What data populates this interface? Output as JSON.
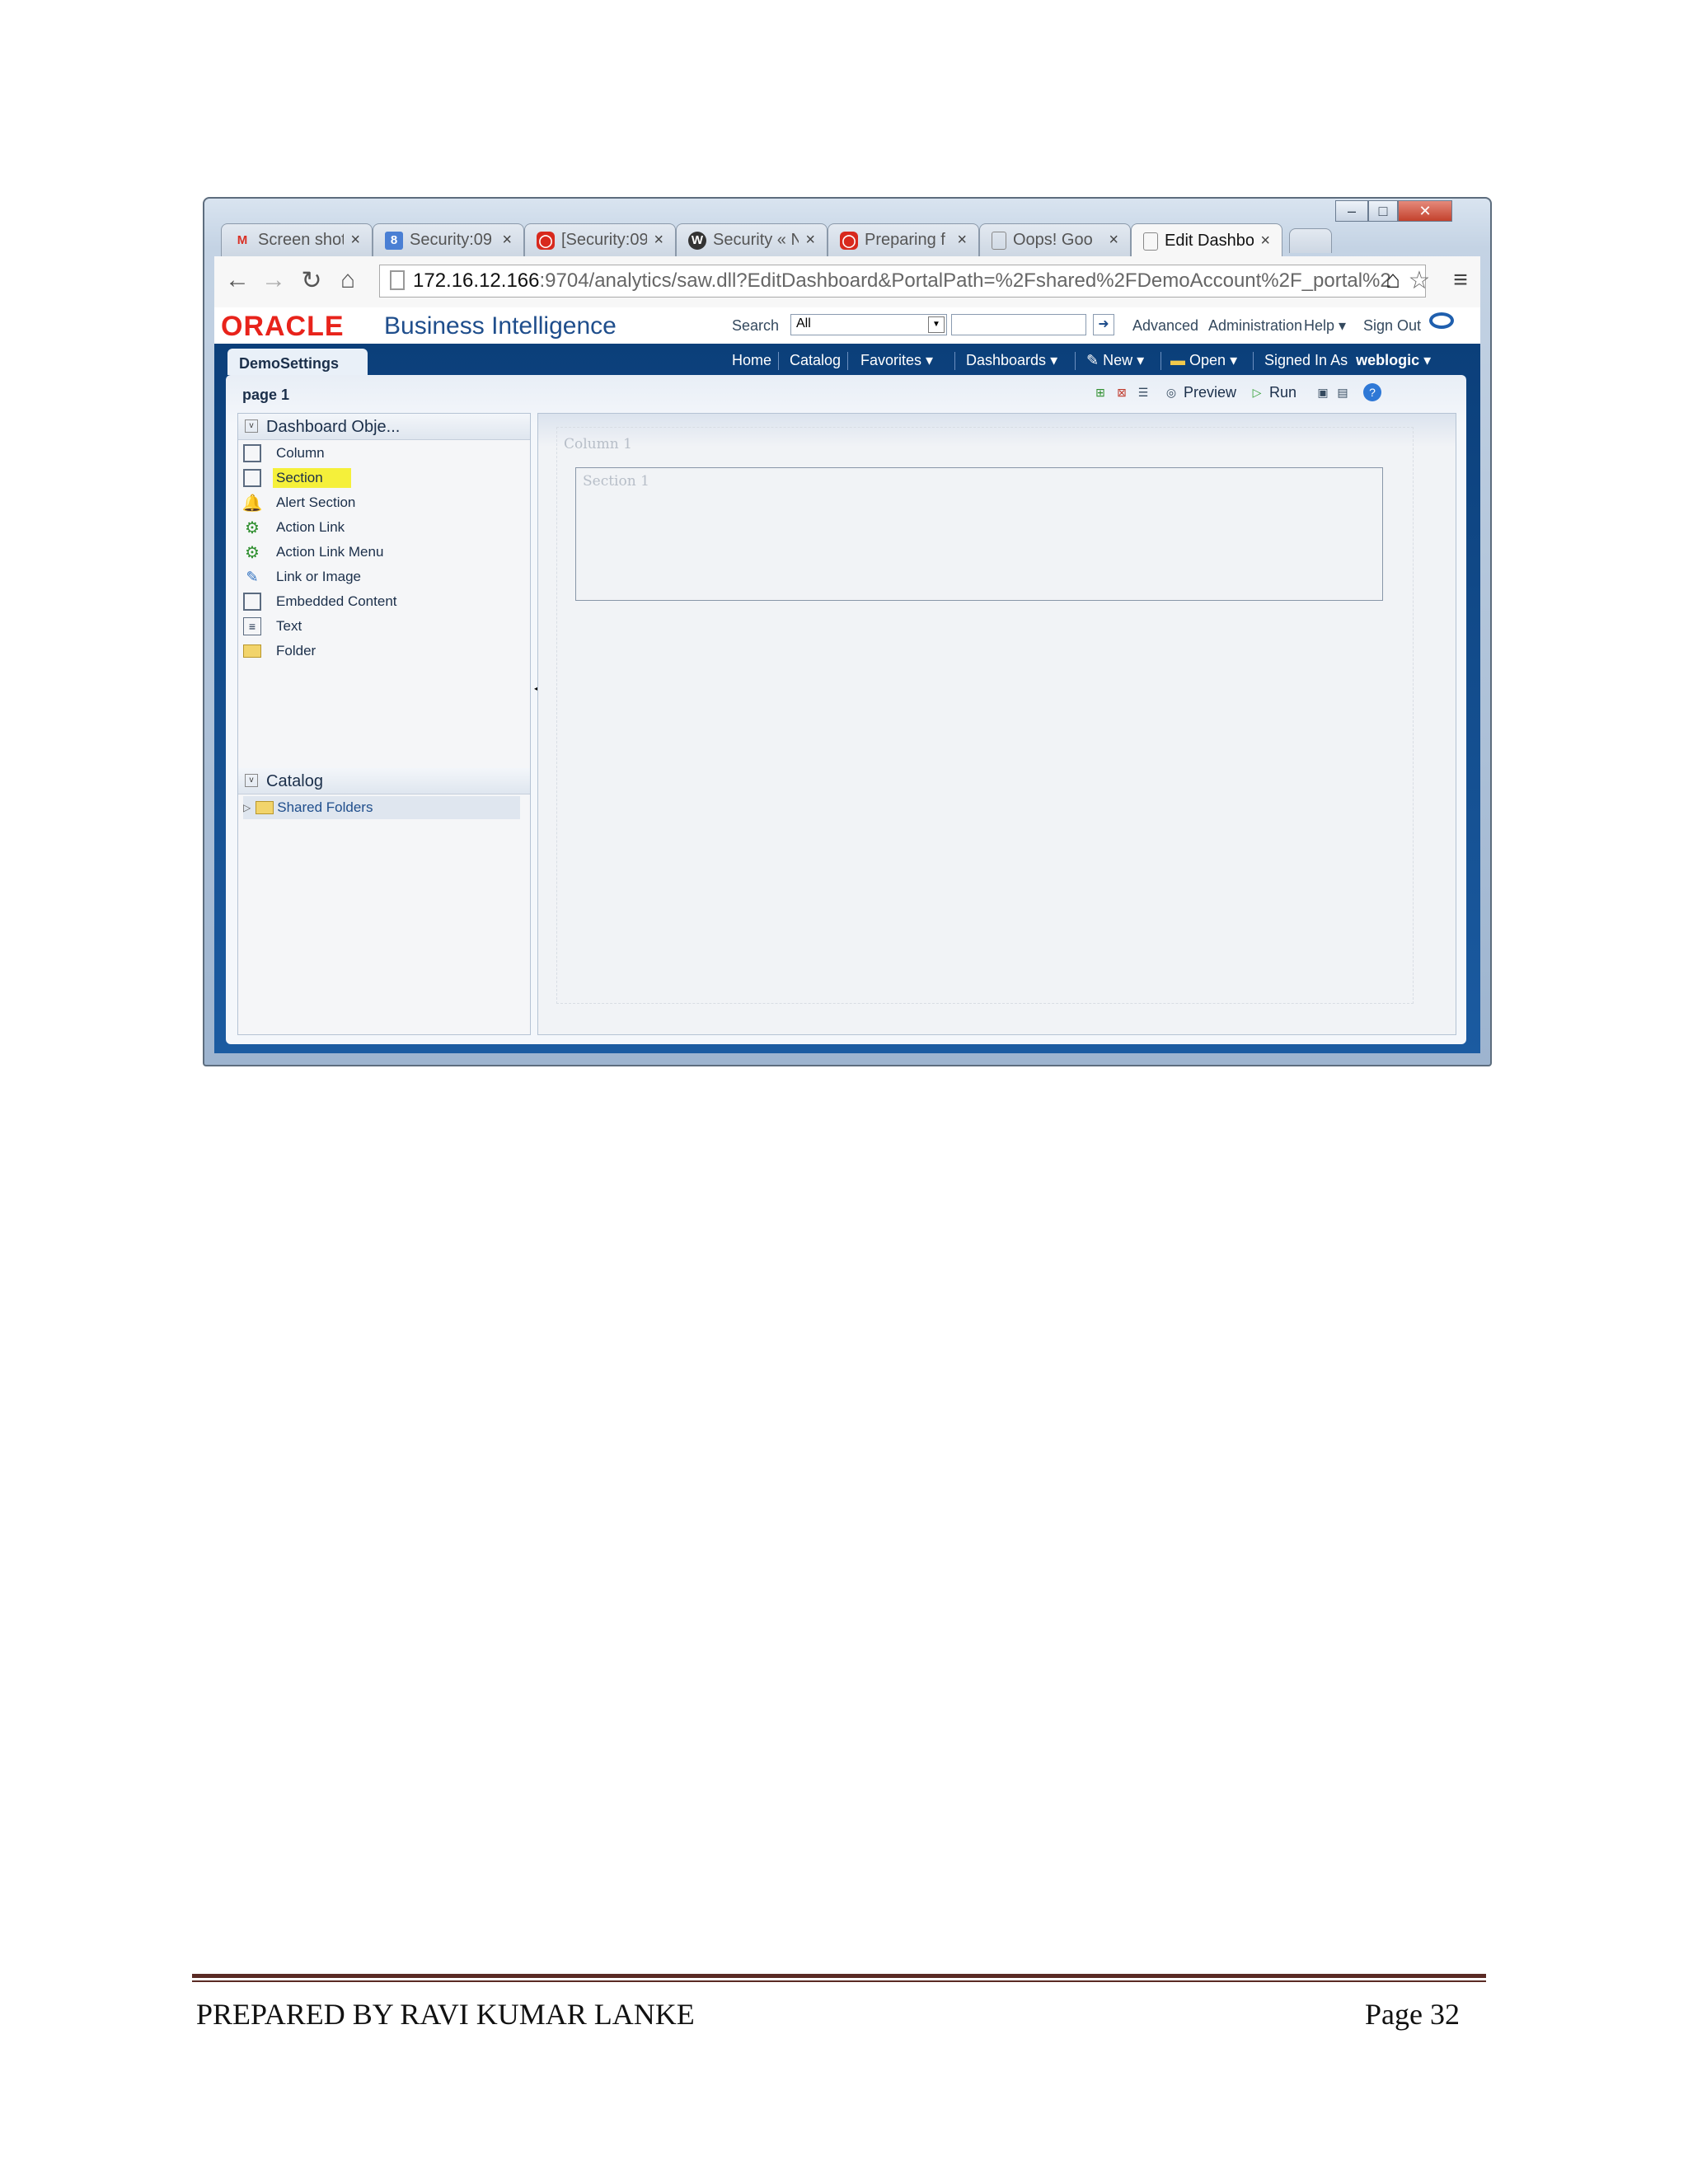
{
  "browser": {
    "tabs": [
      {
        "label": "Screen shot",
        "icon": "gmail-icon"
      },
      {
        "label": "Security:09",
        "icon": "google-icon"
      },
      {
        "label": "[Security:09",
        "icon": "oracle-icon"
      },
      {
        "label": "Security « N",
        "icon": "wordpress-icon"
      },
      {
        "label": "Preparing f",
        "icon": "oracle-icon"
      },
      {
        "label": "Oops! Goo",
        "icon": "page-icon"
      },
      {
        "label": "Edit Dashbo",
        "icon": "page-icon"
      }
    ],
    "url_host": "172.16.12.166",
    "url_path": ":9704/analytics/saw.dll?EditDashboard&PortalPath=%2Fshared%2FDemoAccount%2F_portal%2"
  },
  "header": {
    "logo": "ORACLE",
    "product": "Business Intelligence",
    "search_label": "Search",
    "search_scope": "All",
    "links": [
      "Advanced",
      "Administration",
      "Help",
      "Sign Out"
    ]
  },
  "navbar": {
    "dashboard_tab": "DemoSettings",
    "links": [
      "Home",
      "Catalog",
      "Favorites",
      "Dashboards",
      "New",
      "Open",
      "Signed In As"
    ],
    "user": "weblogic"
  },
  "toolbar": {
    "page_tab": "page 1",
    "preview": "Preview",
    "run": "Run"
  },
  "dashboard_objects": {
    "title": "Dashboard Obje...",
    "items": [
      "Column",
      "Section",
      "Alert Section",
      "Action Link",
      "Action Link Menu",
      "Link or Image",
      "Embedded Content",
      "Text",
      "Folder"
    ],
    "selected": "Section"
  },
  "catalog": {
    "title": "Catalog",
    "items": [
      "Shared Folders"
    ]
  },
  "canvas": {
    "column_label": "Column 1",
    "section_label": "Section 1"
  },
  "footer": {
    "left": "PREPARED BY RAVI KUMAR LANKE",
    "right": "Page 32"
  },
  "colors": {
    "oracle_red": "#e8231b",
    "nav_blue": "#0b3f7a",
    "highlight": "#f5f03a"
  }
}
